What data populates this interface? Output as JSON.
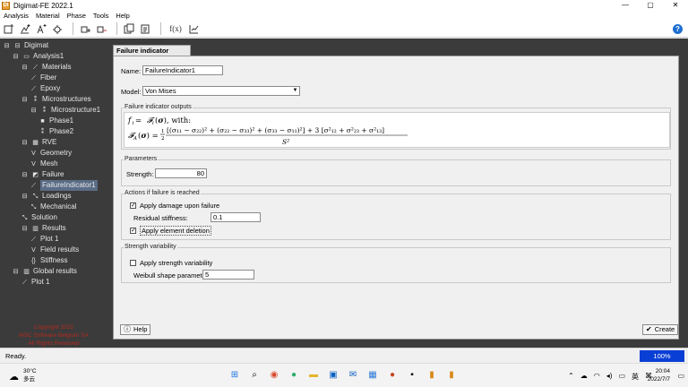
{
  "window": {
    "title": "Digimat-FE 2022.1",
    "app_icon": "DI",
    "controls": [
      "—",
      "▢",
      "✕"
    ]
  },
  "menu": [
    "Analysis",
    "Material",
    "Phase",
    "Tools",
    "Help"
  ],
  "toolbar": {
    "icons": [
      "new-analysis-icon",
      "add-material-icon",
      "add-phase-icon",
      "settings-wheel-icon",
      "add-layer-icon",
      "remove-layer-icon",
      "copy-icon",
      "paste-icon",
      "function-icon",
      "rescale-icon"
    ],
    "fx_label": "f(x)",
    "help_glyph": "?"
  },
  "tree": {
    "items": [
      {
        "label": "Digimat",
        "level": 0,
        "icon": "⊟"
      },
      {
        "label": "Analysis1",
        "level": 1,
        "icon": "⊟"
      },
      {
        "label": "Materials",
        "level": 2,
        "icon": "⊟"
      },
      {
        "label": "Fiber",
        "level": 3,
        "icon": ""
      },
      {
        "label": "Epoxy",
        "level": 3,
        "icon": ""
      },
      {
        "label": "Microstructures",
        "level": 2,
        "icon": "⊟"
      },
      {
        "label": "Microstructure1",
        "level": 3,
        "icon": "⊟"
      },
      {
        "label": "Phase1",
        "level": 4,
        "icon": ""
      },
      {
        "label": "Phase2",
        "level": 4,
        "icon": ""
      },
      {
        "label": "RVE",
        "level": 2,
        "icon": "⊟"
      },
      {
        "label": "Geometry",
        "level": 3,
        "icon": ""
      },
      {
        "label": "Mesh",
        "level": 3,
        "icon": ""
      },
      {
        "label": "Failure",
        "level": 2,
        "icon": "⊟"
      },
      {
        "label": "FailureIndicator1",
        "level": 3,
        "icon": "",
        "selected": true
      },
      {
        "label": "Loadings",
        "level": 2,
        "icon": "⊟"
      },
      {
        "label": "Mechanical",
        "level": 3,
        "icon": ""
      },
      {
        "label": "Solution",
        "level": 2,
        "icon": ""
      },
      {
        "label": "Results",
        "level": 2,
        "icon": "⊟"
      },
      {
        "label": "Plot 1",
        "level": 3,
        "icon": ""
      },
      {
        "label": "Field results",
        "level": 3,
        "icon": ""
      },
      {
        "label": "Stiffness",
        "level": 3,
        "icon": ""
      },
      {
        "label": "Global results",
        "level": 1,
        "icon": "⊟"
      },
      {
        "label": "Plot 1",
        "level": 2,
        "icon": ""
      }
    ],
    "copyright": [
      "Copyright 2022",
      "MSC Software Belgium SA",
      "All Rights Reserved"
    ]
  },
  "form": {
    "tab": "Failure indicator definition",
    "name_label": "Name:",
    "name_value": "FailureIndicator1",
    "model_label": "Model:",
    "model_value": "Von Mises",
    "outputs_title": "Failure indicator outputs",
    "parameters_title": "Parameters",
    "strength_label": "Strength:",
    "strength_value": "80",
    "actions_title": "Actions if failure is reached",
    "apply_damage_label": "Apply damage upon failure",
    "apply_damage_checked": true,
    "residual_label": "Residual stiffness:",
    "residual_value": "0.1",
    "apply_deletion_label": "Apply element deletion",
    "apply_deletion_checked": true,
    "variability_title": "Strength variability",
    "apply_variability_label": "Apply strength variability",
    "apply_variability_checked": false,
    "weibull_label": "Weibull shape parameter:",
    "weibull_value": "5",
    "help_button": "Help",
    "create_button": "Create"
  },
  "status": {
    "text": "Ready.",
    "progress": "100%"
  },
  "taskbar": {
    "temperature": "30°C",
    "weather": "多云",
    "ime": "英",
    "time": "20:04",
    "date": "2022/7/7"
  }
}
